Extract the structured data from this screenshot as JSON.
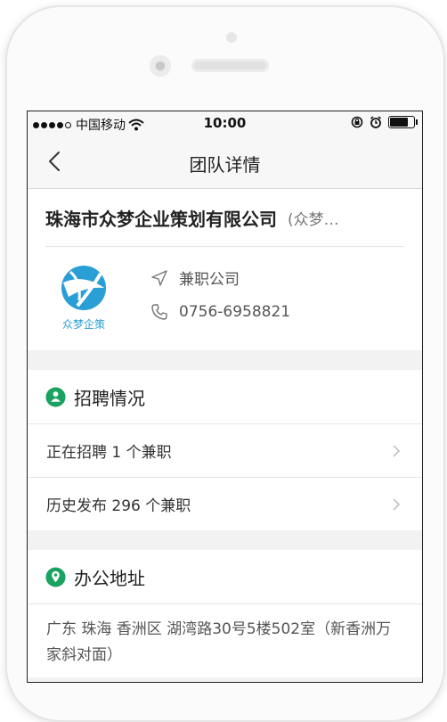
{
  "status_bar": {
    "carrier": "中国移动",
    "time": "10:00"
  },
  "nav": {
    "title": "团队详情"
  },
  "company": {
    "name": "珠海市众梦企业策划有限公司",
    "abbr": "(众梦…",
    "logo_text": "众梦企策",
    "type": "兼职公司",
    "phone": "0756-6958821"
  },
  "recruitment": {
    "title": "招聘情况",
    "rows": [
      {
        "label": "正在招聘 1 个兼职"
      },
      {
        "label": "历史发布 296 个兼职"
      }
    ]
  },
  "office": {
    "title": "办公地址",
    "address": "广东 珠海 香洲区 湖湾路30号5楼502室（新香洲万家斜对面）"
  },
  "colors": {
    "accent_green": "#1aa260",
    "logo_blue": "#2a9fd6"
  }
}
